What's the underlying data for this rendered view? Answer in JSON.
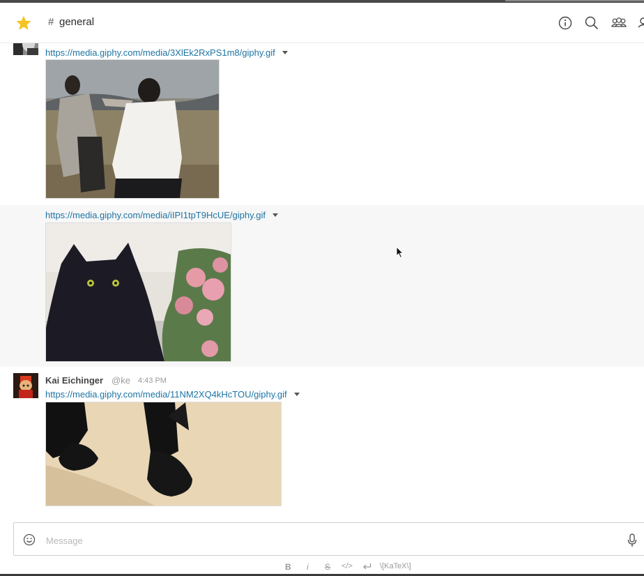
{
  "header": {
    "channel_prefix": "#",
    "channel_name": "general",
    "icons": [
      "star-icon",
      "info-icon",
      "search-icon",
      "members-icon",
      "user-icon"
    ]
  },
  "messages": [
    {
      "link": "https://media.giphy.com/media/3XlEk2RxPS1m8/giphy.gif",
      "image": "gif-two-men-field"
    },
    {
      "link": "https://media.giphy.com/media/iIPI1tpT9HcUE/giphy.gif",
      "image": "gif-black-cat-flowers"
    },
    {
      "author": "Kai Eichinger",
      "handle": "@ke",
      "time": "4:43 PM",
      "link": "https://media.giphy.com/media/11NM2XQ4kHcTOU/giphy.gif",
      "image": "gif-walking-legs"
    }
  ],
  "composer": {
    "placeholder": "Message"
  },
  "format_toolbar": {
    "bold": "B",
    "italic": "i",
    "strike": "S",
    "code": "</>",
    "katex": "\\[KaTeX\\]"
  },
  "colors": {
    "star": "#f3c423",
    "link": "#1d74a4",
    "highlight_row": "#f7f7f7"
  }
}
